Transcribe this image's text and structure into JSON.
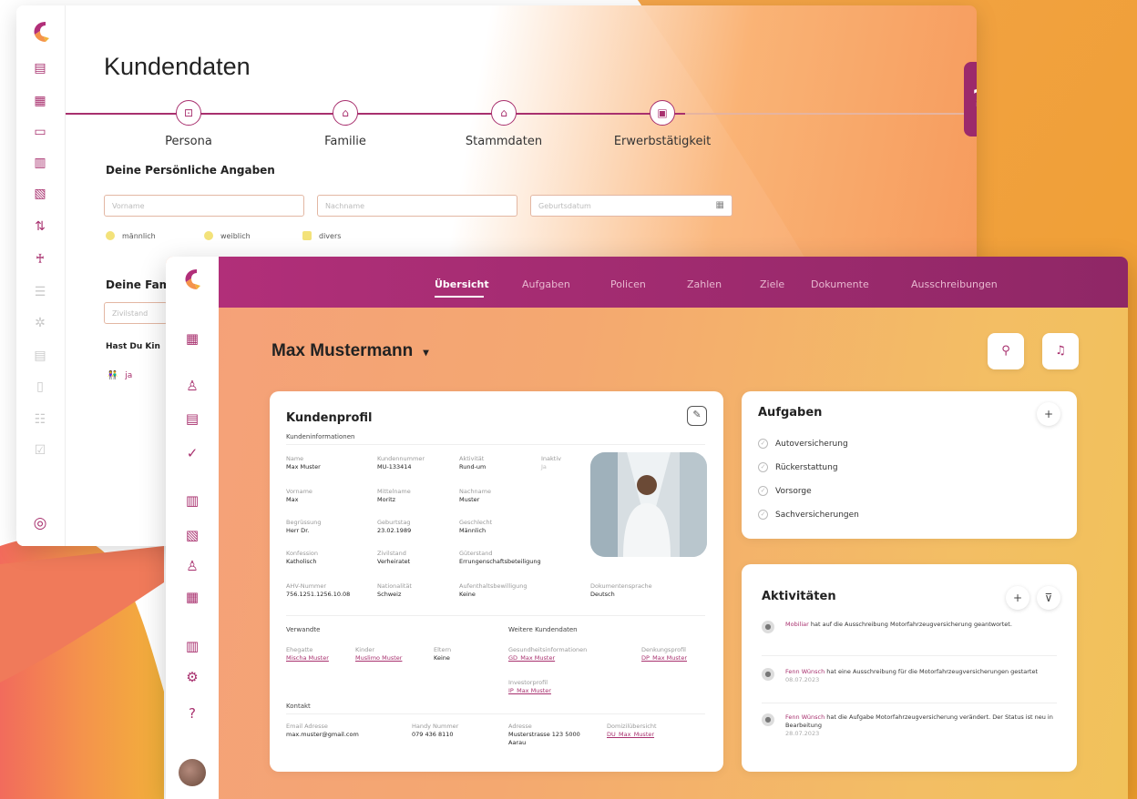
{
  "back": {
    "title": "Kundendaten",
    "steps": [
      "Persona",
      "Familie",
      "Stammdaten",
      "Erwerbstätigkeit"
    ],
    "section1": "Deine Persönliche Angaben",
    "fields": {
      "vorname": "Vorname",
      "nachname": "Nachname",
      "geburtsdatum": "Geburtsdatum"
    },
    "genders": [
      "männlich",
      "weiblich",
      "divers"
    ],
    "section2": "Deine Fam",
    "zivilstand": "Zivilstand",
    "kinder_q": "Hast Du Kin",
    "kinder_opt": "ja",
    "help": "?"
  },
  "front": {
    "tabs": [
      "Übersicht",
      "Aufgaben",
      "Policen",
      "Zahlen",
      "Ziele",
      "Dokumente",
      "Ausschreibungen"
    ],
    "customer": "Max Mustermann",
    "caret": "▾",
    "profile": {
      "title": "Kundenprofil",
      "subtitle": "Kundeninformationen",
      "fields": [
        {
          "k": "Name",
          "v": "Max Muster"
        },
        {
          "k": "Kundennummer",
          "v": "MU-133414"
        },
        {
          "k": "Aktivität",
          "v": "Rund-um"
        },
        {
          "k": "Inaktiv",
          "v": "Ja"
        },
        {
          "k": "Vorname",
          "v": "Max"
        },
        {
          "k": "Mittelname",
          "v": "Moritz"
        },
        {
          "k": "Nachname",
          "v": "Muster"
        },
        {
          "k": "Begrüssung",
          "v": "Herr Dr."
        },
        {
          "k": "Geburtstag",
          "v": "23.02.1989"
        },
        {
          "k": "Geschlecht",
          "v": "Männlich"
        },
        {
          "k": "Konfession",
          "v": "Katholisch"
        },
        {
          "k": "Zivilstand",
          "v": "Verheiratet"
        },
        {
          "k": "Güterstand",
          "v": "Errungenschaftsbeteiligung"
        },
        {
          "k": "AHV-Nummer",
          "v": "756.1251.1256.10.08"
        },
        {
          "k": "Nationalität",
          "v": "Schweiz"
        },
        {
          "k": "Aufenthaltsbewilligung",
          "v": "Keine"
        },
        {
          "k": "Dokumentensprache",
          "v": "Deutsch"
        }
      ],
      "verwandte": "Verwandte",
      "weitere": "Weitere Kundendaten",
      "rel": [
        {
          "k": "Ehegatte",
          "v": "Mischa Muster"
        },
        {
          "k": "Kinder",
          "v": "Muslimo Muster"
        },
        {
          "k": "Eltern",
          "v": "Keine"
        },
        {
          "k": "Gesundheitsinformationen",
          "v": "GD_Max Muster"
        },
        {
          "k": "Denkungsprofil",
          "v": "DP_Max Muster"
        },
        {
          "k": "Investorprofil",
          "v": "IP_Max Muster"
        }
      ],
      "kontakt": "Kontakt",
      "contact": [
        {
          "k": "Email Adresse",
          "v": "max.muster@gmail.com"
        },
        {
          "k": "Handy Nummer",
          "v": "079 436 8110"
        },
        {
          "k": "Adresse",
          "v": "Musterstrasse 123 5000 Aarau"
        },
        {
          "k": "Domizilübersicht",
          "v": "DU_Max_Muster"
        }
      ]
    },
    "tasks": {
      "title": "Aufgaben",
      "add": "+",
      "items": [
        "Autoversicherung",
        "Rückerstattung",
        "Vorsorge",
        "Sachversicherungen"
      ]
    },
    "activities": {
      "title": "Aktivitäten",
      "add": "+",
      "filter": "⊽",
      "items": [
        {
          "who": "Mobiliar",
          "text": "hat auf die Ausschreibung Motorfahrzeugversicherung geantwortet.",
          "date": ""
        },
        {
          "who": "Fenn Wünsch",
          "text": "hat eine Ausschreibung für die Motorfahrzeugversicherungen gestartet",
          "date": "08.07.2023"
        },
        {
          "who": "Fenn Wünsch",
          "text": "hat die Aufgabe Motorfahrzeugversicherung verändert. Der Status ist neu in Bearbeitung",
          "date": "28.07.2023"
        }
      ]
    }
  }
}
